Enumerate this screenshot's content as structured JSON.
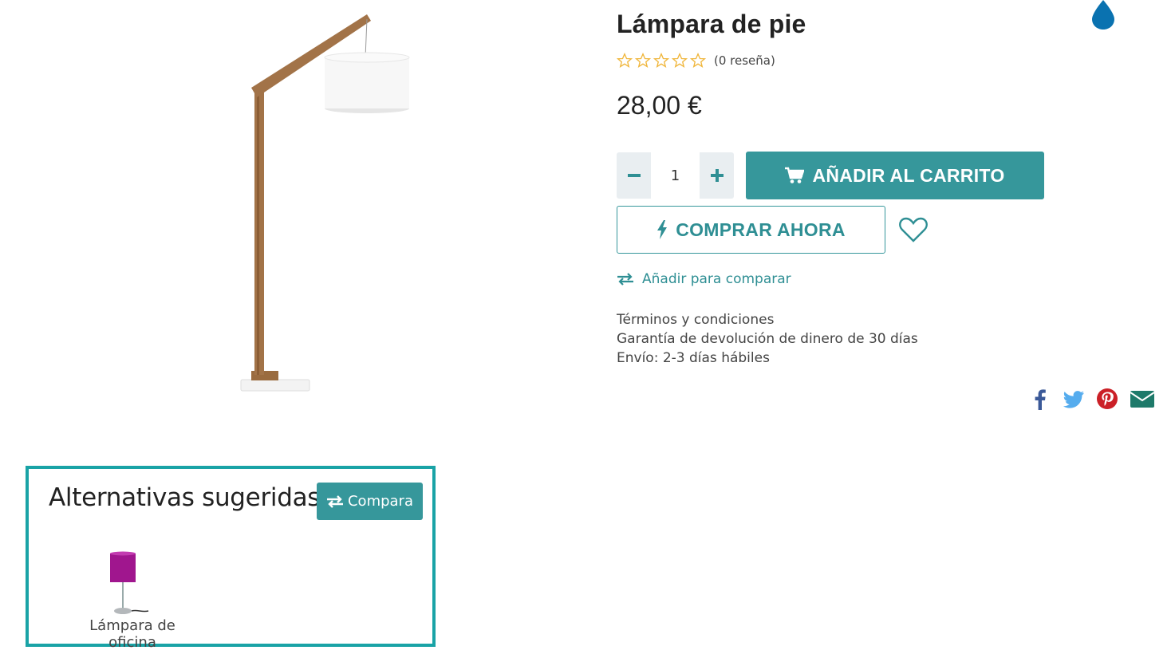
{
  "product": {
    "title": "Lámpara de pie",
    "rating_stars": 0,
    "review_count": "(0 reseña)",
    "price": "28,00 €",
    "quantity": "1"
  },
  "actions": {
    "add_to_cart": "AÑADIR AL CARRITO",
    "buy_now": "COMPRAR AHORA",
    "compare_link": "Añadir para comparar"
  },
  "info": {
    "terms": "Términos y condiciones",
    "guarantee": "Garantía de devolución de dinero de 30 días",
    "shipping": "Envío: 2-3 días hábiles"
  },
  "share": {
    "icons": [
      "facebook-icon",
      "twitter-icon",
      "pinterest-icon",
      "envelope-icon"
    ],
    "colors": {
      "facebook": "#3b5998",
      "twitter": "#55acee",
      "pinterest": "#cb2027",
      "email": "#1e7a6a"
    }
  },
  "suggestions": {
    "title": "Alternativas sugeridas:",
    "compare_button": "Compara",
    "items": [
      {
        "name": "Lámpara de oficina"
      }
    ]
  },
  "colors": {
    "accent": "#36979b",
    "accent_text": "#2f8f94",
    "box_border": "#19a3a6",
    "star": "#f0b63b",
    "drop": "#0a72b0"
  }
}
